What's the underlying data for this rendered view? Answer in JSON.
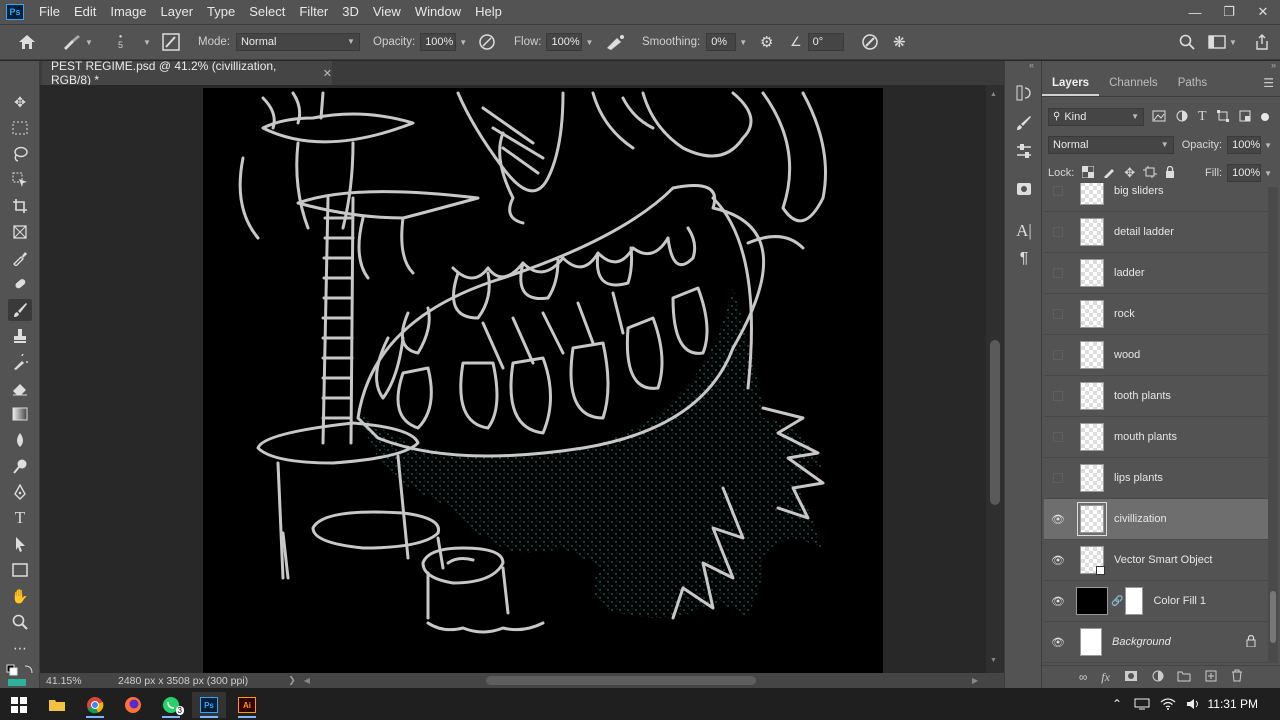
{
  "menubar": {
    "logo": "Ps",
    "items": [
      "File",
      "Edit",
      "Image",
      "Layer",
      "Type",
      "Select",
      "Filter",
      "3D",
      "View",
      "Window",
      "Help"
    ]
  },
  "options": {
    "brush_size": "5",
    "mode_label": "Mode:",
    "mode_value": "Normal",
    "opacity_label": "Opacity:",
    "opacity_value": "100%",
    "flow_label": "Flow:",
    "flow_value": "100%",
    "smoothing_label": "Smoothing:",
    "smoothing_value": "0%",
    "angle_value": "0°"
  },
  "document": {
    "tab_title": "PEST REGIME.psd @ 41.2% (civillization, RGB/8) *",
    "zoom": "41.15%",
    "dimensions": "2480 px x 3508 px (300 ppi)"
  },
  "layers_panel": {
    "tabs": [
      "Layers",
      "Channels",
      "Paths"
    ],
    "filter_value": "Kind",
    "blend_mode": "Normal",
    "opacity_label": "Opacity:",
    "opacity_value": "100%",
    "lock_label": "Lock:",
    "fill_label": "Fill:",
    "fill_value": "100%",
    "layers": [
      {
        "name": "big sliders",
        "visible": false
      },
      {
        "name": "detail ladder",
        "visible": false
      },
      {
        "name": "ladder",
        "visible": false
      },
      {
        "name": "rock",
        "visible": false
      },
      {
        "name": "wood",
        "visible": false
      },
      {
        "name": "tooth plants",
        "visible": false
      },
      {
        "name": "mouth plants",
        "visible": false
      },
      {
        "name": "lips plants",
        "visible": false
      },
      {
        "name": "civillization",
        "visible": true,
        "selected": true
      },
      {
        "name": "Vector Smart Object",
        "visible": true
      },
      {
        "name": "Color Fill 1",
        "visible": true
      },
      {
        "name": "Background",
        "visible": true,
        "locked": true
      }
    ]
  },
  "taskbar": {
    "whatsapp_badge": "3",
    "time": "11:31 PM"
  },
  "colors": {
    "accent": "#31a8ff",
    "line_art": "#c8c8c8",
    "speckle": "#2f8a7c"
  }
}
